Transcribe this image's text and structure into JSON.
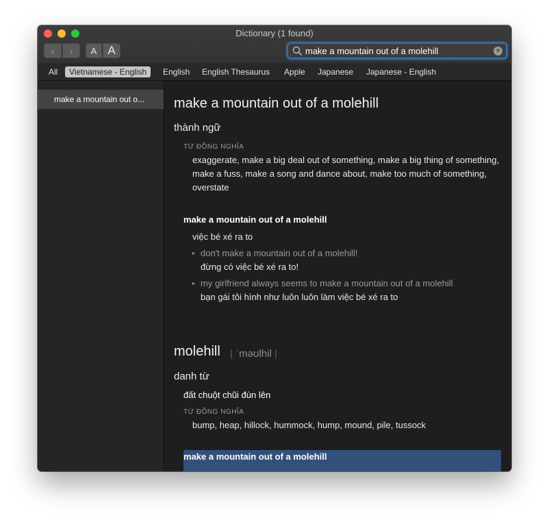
{
  "window": {
    "title": "Dictionary (1 found)"
  },
  "toolbar": {
    "back_label": "‹",
    "forward_label": "›",
    "font_small_label": "A",
    "font_large_label": "A"
  },
  "search": {
    "value": "make a mountain out of a molehill",
    "clear_label": "×"
  },
  "tabs": [
    {
      "label": "All"
    },
    {
      "label": "Vietnamese - English"
    },
    {
      "label": "English"
    },
    {
      "label": "English Thesaurus"
    },
    {
      "label": "Apple"
    },
    {
      "label": "Japanese"
    },
    {
      "label": "Japanese - English"
    }
  ],
  "sidebar": {
    "items": [
      {
        "label": "make a mountain out o..."
      }
    ]
  },
  "entry1": {
    "headword": "make a mountain out of a molehill",
    "pos": "thành ngữ",
    "synonyms_label": "TỪ ĐỒNG NGHĨA",
    "synonyms": "exaggerate, make a big deal out of something, make a big thing of something, make a fuss, make a song and dance about, make too much of something, overstate",
    "phrase": "make a mountain out of a molehill",
    "meaning": "việc bé xé ra to",
    "examples": [
      {
        "en": "don't make a mountain out of a molehill!",
        "vi": "đừng có việc bé xé ra to!"
      },
      {
        "en": "my girlfriend always seems to make a mountain out of a molehill",
        "vi": "bạn gái tôi hình như luôn luôn làm việc bé xé ra to"
      }
    ]
  },
  "entry2": {
    "headword": "molehill",
    "pronunciation": "ˈməʊlhil",
    "pos": "danh từ",
    "meaning": "đất chuột chũi đùn lên",
    "synonyms_label": "TỪ ĐỒNG NGHĨA",
    "synonyms": "bump, heap, hillock, hummock, hump, mound, pile, tussock",
    "phrase": "make a mountain out of a molehill"
  }
}
